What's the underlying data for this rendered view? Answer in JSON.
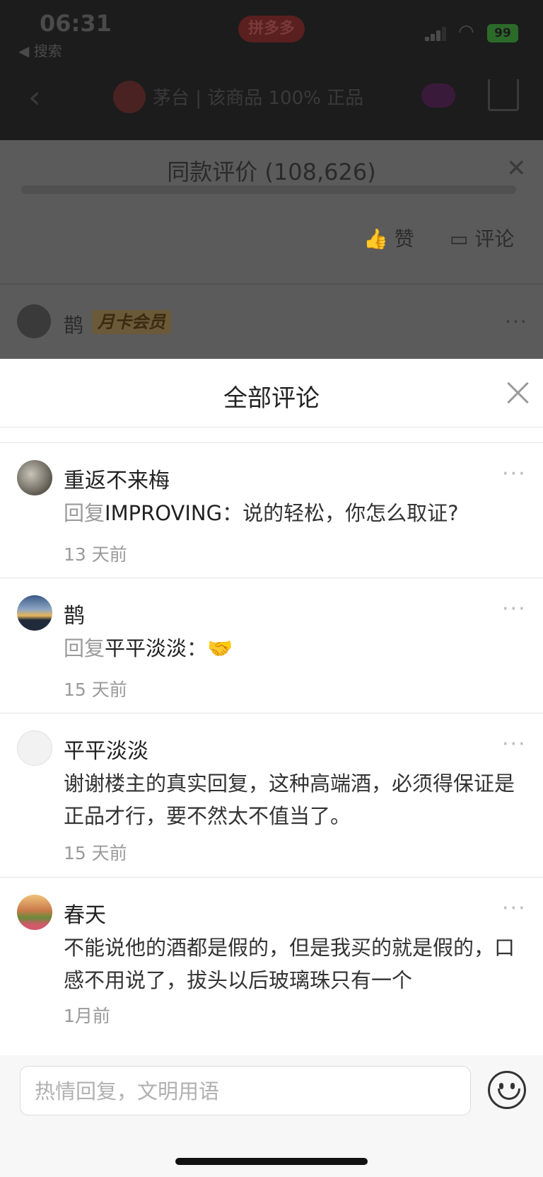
{
  "status_bar": {
    "time": "06:31",
    "back_label": "◀ 搜索",
    "app_name": "拼多多",
    "battery": "99"
  },
  "nav": {
    "title": "茅台 | 该商品 100% 正品"
  },
  "background_panel": {
    "title": "同款评价 (108,626)",
    "like_label": "赞",
    "comment_label": "评论",
    "user": "鹊",
    "badge": "月卡会员"
  },
  "sheet": {
    "title": "全部评论",
    "comments": [
      {
        "user": "重返不来梅",
        "reply_prefix": "回复",
        "reply_to": "IMPROVING",
        "text": "：说的轻松，你怎么取证?",
        "time": "13 天前"
      },
      {
        "user": "鹊",
        "reply_prefix": "回复",
        "reply_to": "平平淡淡",
        "text": "：",
        "emoji": "🤝",
        "time": "15 天前"
      },
      {
        "user": "平平淡淡",
        "text": "谢谢楼主的真实回复，这种高端酒，必须得保证是正品才行，要不然太不值当了。",
        "time": "15 天前"
      },
      {
        "user": "春天",
        "text": "不能说他的酒都是假的，但是我买的就是假的，口感不用说了，拔头以后玻璃珠只有一个",
        "time": "1月前"
      }
    ]
  },
  "input": {
    "placeholder": "热情回复，文明用语"
  },
  "colors": {
    "accent_red": "#e02e24",
    "text_gray": "#9a9a9a",
    "battery_green": "#34c759"
  }
}
